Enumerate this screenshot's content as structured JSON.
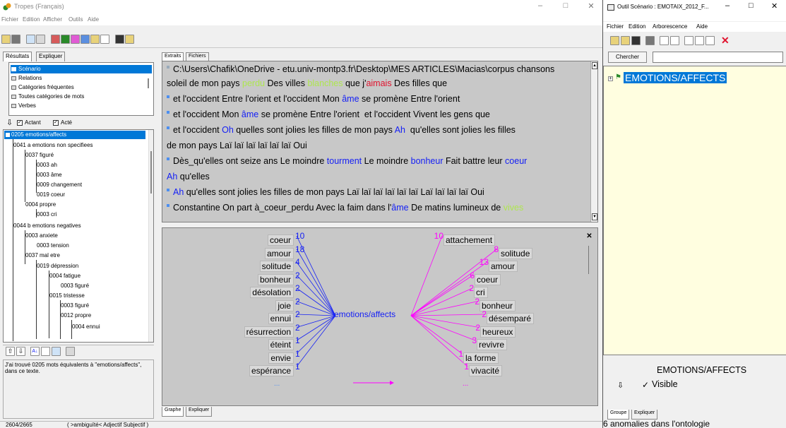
{
  "tropes": {
    "title": "Tropes (Français)",
    "menu": [
      "Fichier",
      "Edition",
      "Afficher",
      "Outils",
      "Aide"
    ],
    "controls": {
      "minimize": "–",
      "maximize": "□",
      "close": "✕"
    },
    "left_tabs": [
      "Résultats",
      "Expliquer"
    ],
    "result_list": [
      "Scénario",
      "Relations",
      "Catégories fréquentes",
      "Toutes catégories de mots",
      "Verbes"
    ],
    "actant_label": "Actant",
    "acte_label": "Acté",
    "tree": {
      "root": "0205 emotions/affects",
      "items": [
        "0041 a emotions non specifiees",
        "0037 figuré",
        "0003 ah",
        "0003 âme",
        "0009 changement",
        "0019 coeur",
        "0004 propre",
        "0003 cri",
        "0044 b emotions negatives",
        "0003 anxiete",
        "0003 tension",
        "0037 mal etre",
        "0019 dépression",
        "0004 fatigue",
        "0003 figuré",
        "0015 tristesse",
        "0003 figuré",
        "0012 propre",
        "0004 ennui"
      ]
    },
    "info_text": "J'ai trouvé 0205 mots équivalents à \"emotions/affects\", dans ce texte.",
    "extract_tabs": [
      "Extraits",
      "Fichiers"
    ],
    "extract_path": "C:\\Users\\Chafik\\OneDrive - etu.univ-montp3.fr\\Desktop\\MES ARTICLES\\Macias\\corpus chansons",
    "graph_tabs": [
      "Graphe",
      "Expliquer"
    ],
    "graph_close": "✕",
    "graph_center": "emotions/affects",
    "left_words": [
      {
        "word": "coeur",
        "n": "10"
      },
      {
        "word": "amour",
        "n": "18"
      },
      {
        "word": "solitude",
        "n": "4"
      },
      {
        "word": "bonheur",
        "n": "2"
      },
      {
        "word": "désolation",
        "n": "2"
      },
      {
        "word": "joie",
        "n": "2"
      },
      {
        "word": "ennui",
        "n": "2"
      },
      {
        "word": "résurrection",
        "n": "2"
      },
      {
        "word": "éteint",
        "n": "1"
      },
      {
        "word": "envie",
        "n": "1"
      },
      {
        "word": "espérance",
        "n": "1"
      }
    ],
    "right_words": [
      {
        "word": "attachement",
        "n": "10"
      },
      {
        "word": "solitude",
        "n": "8"
      },
      {
        "word": "amour",
        "n": "13"
      },
      {
        "word": "coeur",
        "n": "6"
      },
      {
        "word": "cri",
        "n": "2"
      },
      {
        "word": "bonheur",
        "n": "2"
      },
      {
        "word": "désemparé",
        "n": "2"
      },
      {
        "word": "heureux",
        "n": "2"
      },
      {
        "word": "revivre",
        "n": "3"
      },
      {
        "word": "la forme",
        "n": "1"
      },
      {
        "word": "vivacité",
        "n": "1"
      }
    ],
    "ellipsis": "...",
    "status_left": "2604/2665",
    "status_right": "( >ambiguïté< Adjectif Subjectif )"
  },
  "scenario": {
    "title": "Outil Scénario : EMOTAIX_2012_F...",
    "menu": [
      "Fichier",
      "Edition",
      "Arborescence",
      "Aide"
    ],
    "search_button": "Chercher",
    "search_value": "",
    "tree_root": "EMOTIONS/AFFECTS",
    "selected_label": "EMOTIONS/AFFECTS",
    "visible_label": "Visible",
    "bottom_tabs": [
      "Groupe",
      "Expliquer"
    ],
    "status": "6 anomalies dans l'ontologie"
  },
  "colors": {
    "selection": "#0078d7",
    "blue_word": "#1520f5",
    "green_word": "#aee64f",
    "red_word": "#e0132e",
    "magenta": "#ff00ff",
    "scenario_bg": "#fffee0"
  }
}
